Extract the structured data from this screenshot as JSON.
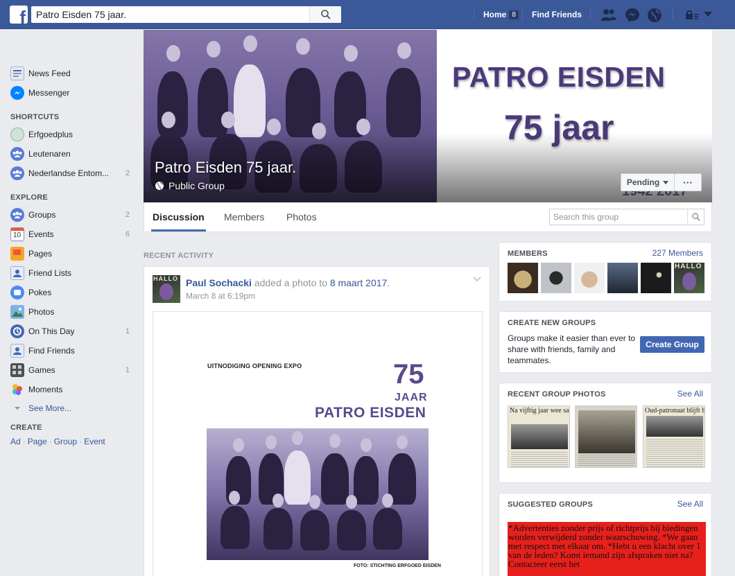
{
  "topbar": {
    "search_value": "Patro Eisden 75 jaar.",
    "home_label": "Home",
    "home_count": "8",
    "find_friends_label": "Find Friends"
  },
  "sidebar": {
    "main": [
      {
        "label": "News Feed",
        "icon": "news-feed-icon",
        "count": ""
      },
      {
        "label": "Messenger",
        "icon": "messenger-icon",
        "count": ""
      }
    ],
    "shortcuts_heading": "SHORTCUTS",
    "shortcuts": [
      {
        "label": "Erfgoedplus",
        "icon": "group-avatar-icon",
        "count": ""
      },
      {
        "label": "Leutenaren",
        "icon": "group-icon",
        "count": ""
      },
      {
        "label": "Nederlandse Entom...",
        "icon": "group-icon",
        "count": "2"
      }
    ],
    "explore_heading": "EXPLORE",
    "explore": [
      {
        "label": "Groups",
        "icon": "groups-icon",
        "count": "2"
      },
      {
        "label": "Events",
        "icon": "calendar-icon",
        "count": "6"
      },
      {
        "label": "Pages",
        "icon": "pages-flag-icon",
        "count": ""
      },
      {
        "label": "Friend Lists",
        "icon": "friend-lists-icon",
        "count": ""
      },
      {
        "label": "Pokes",
        "icon": "pokes-icon",
        "count": ""
      },
      {
        "label": "Photos",
        "icon": "photos-icon",
        "count": ""
      },
      {
        "label": "On This Day",
        "icon": "on-this-day-icon",
        "count": "1"
      },
      {
        "label": "Find Friends",
        "icon": "find-friends-icon",
        "count": ""
      },
      {
        "label": "Games",
        "icon": "games-icon",
        "count": "1"
      },
      {
        "label": "Moments",
        "icon": "moments-icon",
        "count": ""
      }
    ],
    "see_more": "See More...",
    "create_heading": "CREATE",
    "create_links": [
      "Ad",
      "Page",
      "Group",
      "Event"
    ]
  },
  "cover": {
    "banner_line1": "PATRO EISDEN",
    "banner_line2": "75 jaar",
    "banner_years": "1942 2017",
    "group_name": "Patro Eisden 75 jaar.",
    "group_type": "Public Group",
    "pending_label": "Pending",
    "more_label": "···"
  },
  "tabs": {
    "items": [
      "Discussion",
      "Members",
      "Photos"
    ],
    "search_placeholder": "Search this group"
  },
  "recent_activity": {
    "heading": "RECENT ACTIVITY",
    "post": {
      "avatar_text": "HALLO",
      "author": "Paul Sochacki",
      "action": " added a photo to ",
      "album": "8 maart 2017",
      "period": ".",
      "time": "March 8 at 6:19pm",
      "photo": {
        "invite": "UITNODIGING OPENING EXPO",
        "big_number": "75",
        "jaar": "JAAR",
        "name": "PATRO EISDEN",
        "credit": "FOTO: STICHTING ERFGOED EISDEN"
      }
    }
  },
  "right": {
    "members": {
      "title": "MEMBERS",
      "count_link": "227 Members",
      "thumb_text": "HALLO"
    },
    "create_groups": {
      "title": "CREATE NEW GROUPS",
      "text": "Groups make it easier than ever to share with friends, family and teammates.",
      "button": "Create Group"
    },
    "recent_photos": {
      "title": "RECENT GROUP PHOTOS",
      "see_all": "See All",
      "thumbs": [
        "Na vijftig jaar wee samen met stichter",
        "",
        "Oud-patronaat blijft bestaa"
      ]
    },
    "suggested": {
      "title": "SUGGESTED GROUPS",
      "see_all": "See All",
      "text": "*Advertenties zonder prijs of richtprijs bij biedingen worden verwijderd zonder waarschuwing. *We gaan met respect met elkaar om. *Hebt u een klacht over 1 van de leden? Komt iemand zijn afspraken niet na? Contacteer eerst het"
    }
  },
  "colors": {
    "brand": "#3b5998",
    "button_blue": "#4267b2",
    "link": "#365899",
    "cover_purple": "#4a3a7a"
  }
}
